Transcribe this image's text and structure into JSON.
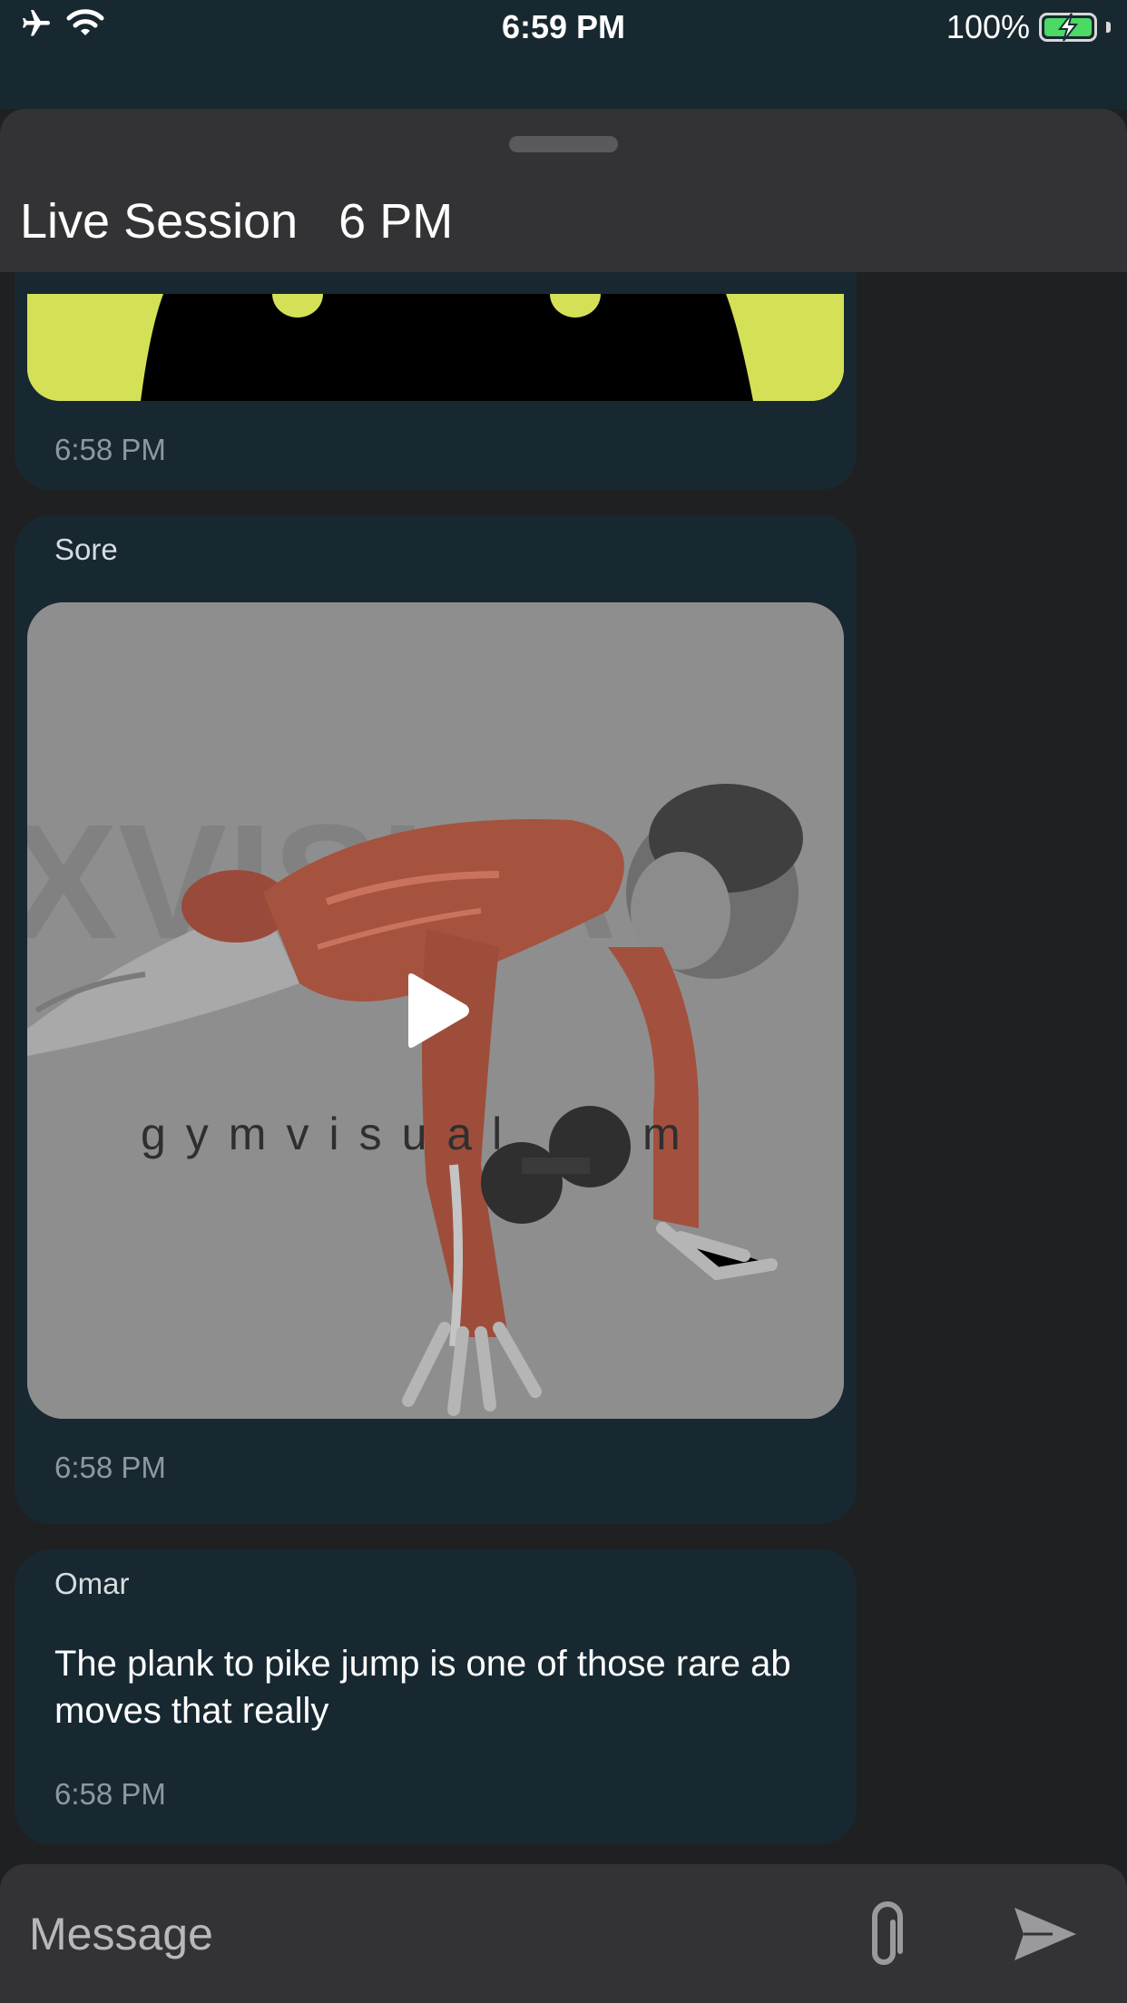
{
  "status_bar": {
    "time": "6:59 PM",
    "battery_text": "100%",
    "left_icons": [
      "airplane-mode-icon",
      "wifi-icon"
    ],
    "battery_icon": "battery-charging-icon",
    "battery_color": "#4cd964"
  },
  "header": {
    "title": "Live Session   6 PM"
  },
  "messages": [
    {
      "type": "image",
      "sender": "",
      "time": "6:58 PM",
      "image_colors": {
        "accent": "#d4e157",
        "dark": "#000000"
      }
    },
    {
      "type": "video",
      "sender": "Sore",
      "time": "6:58 PM",
      "watermark": "gymvisual.com",
      "play_icon": "play-icon"
    },
    {
      "type": "text",
      "sender": "Omar",
      "text": "The plank to pike jump is one of those rare ab moves that really",
      "time": "6:58 PM"
    }
  ],
  "composer": {
    "placeholder": "Message",
    "value": "",
    "attach_icon": "paperclip-icon",
    "send_icon": "send-icon"
  },
  "colors": {
    "bubble_bg": "#182831",
    "sheet_bg": "#333335",
    "page_bg": "#1f2022",
    "timestamp": "#8d999f"
  }
}
